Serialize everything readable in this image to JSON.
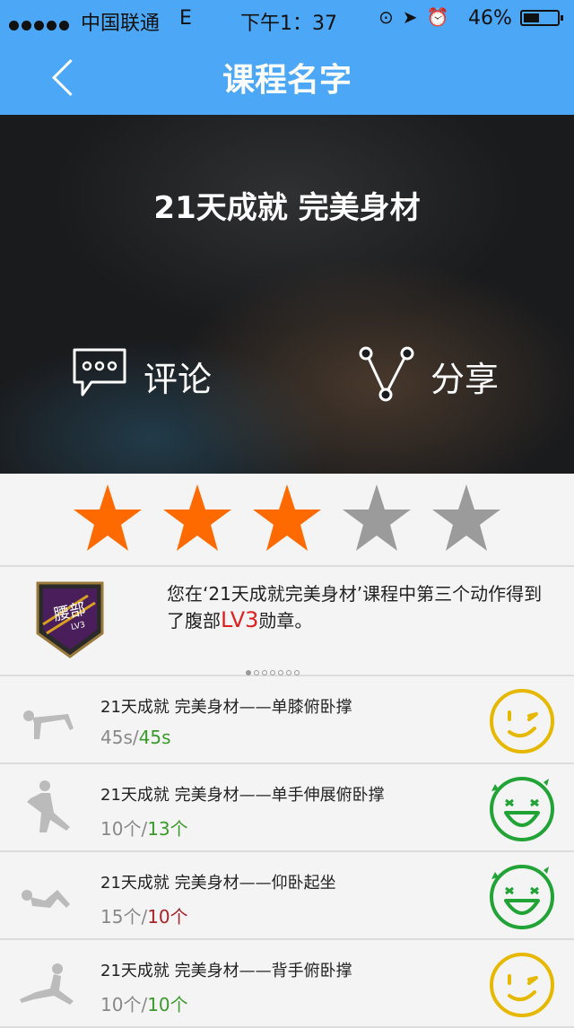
{
  "status_bar": {
    "carrier": "中国联通",
    "network": "E",
    "time": "下午1：37",
    "icons": [
      "lock-rotation-icon",
      "location-arrow-icon",
      "alarm-icon"
    ],
    "battery_percent": "46%",
    "battery_level": 0.46
  },
  "nav": {
    "back_icon": "chevron-left-icon",
    "title": "课程名字"
  },
  "hero": {
    "course_title": "21天成就 完美身材",
    "comment_label": "评论",
    "share_label": "分享"
  },
  "rating": {
    "stars_filled": 3,
    "stars_total": 5,
    "filled_color": "#ff6a00",
    "empty_color": "#9b9b9b"
  },
  "badge": {
    "emblem_text": "腰部",
    "emblem_level": "LV3",
    "message_prefix": "您在‘21天成就完美身材’课程中第三个动作得到了腹部",
    "message_level": "LV3",
    "message_suffix": "勋章。",
    "pager_count": 7,
    "pager_active": 0
  },
  "exercises": [
    {
      "name": "21天成就 完美身材——单膝俯卧撑",
      "done": "45s",
      "target": "45s",
      "target_color": "#3a9a2a",
      "face": "wink-face-icon",
      "face_color": "#e6b800"
    },
    {
      "name": "21天成就 完美身材——单手伸展俯卧撑",
      "done": "10个",
      "target": "13个",
      "target_color": "#3a9a2a",
      "face": "laughing-face-icon",
      "face_color": "#21a336"
    },
    {
      "name": "21天成就 完美身材——仰卧起坐",
      "done": "15个",
      "target": "10个",
      "target_color": "#a8232a",
      "face": "laughing-face-icon",
      "face_color": "#21a336"
    },
    {
      "name": "21天成就 完美身材——背手俯卧撑",
      "done": "10个",
      "target": "10个",
      "target_color": "#3a9a2a",
      "face": "wink-face-icon",
      "face_color": "#e6b800"
    }
  ]
}
